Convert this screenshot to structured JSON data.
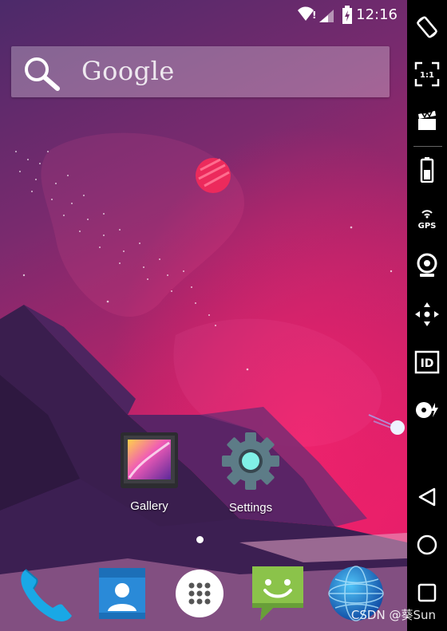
{
  "status_bar": {
    "time": "12:16",
    "icons": [
      "wifi-icon",
      "signal-icon",
      "battery-charging-icon"
    ]
  },
  "search": {
    "label": "Google",
    "icon": "search-icon"
  },
  "apps": [
    {
      "label": "Gallery",
      "icon": "gallery-icon"
    },
    {
      "label": "Settings",
      "icon": "settings-gear-icon"
    }
  ],
  "dock": [
    {
      "icon": "phone-icon"
    },
    {
      "icon": "contacts-icon"
    },
    {
      "icon": "app-drawer-icon"
    },
    {
      "icon": "messaging-icon"
    },
    {
      "icon": "browser-globe-icon"
    }
  ],
  "emulator_toolbar": [
    {
      "icon": "rotate-icon"
    },
    {
      "icon": "scale-1-1-icon",
      "text": "1:1"
    },
    {
      "icon": "screen-record-icon"
    },
    {
      "icon": "battery-icon"
    },
    {
      "icon": "gps-icon",
      "text": "GPS"
    },
    {
      "icon": "camera-icon"
    },
    {
      "icon": "dpad-icon"
    },
    {
      "icon": "device-id-icon",
      "text": "ID"
    },
    {
      "icon": "media-icon"
    }
  ],
  "nav_buttons": [
    {
      "icon": "back-icon"
    },
    {
      "icon": "home-icon"
    },
    {
      "icon": "recents-icon"
    }
  ],
  "watermark": "CSDN @葵Sun",
  "colors": {
    "wallpaper_top": "#4c2a6a",
    "wallpaper_mid": "#9c2565",
    "wallpaper_bottom": "#e01e69",
    "mountain_dark": "#3a1e4e",
    "planet": "#ec2a5c",
    "panel": "#000000"
  }
}
